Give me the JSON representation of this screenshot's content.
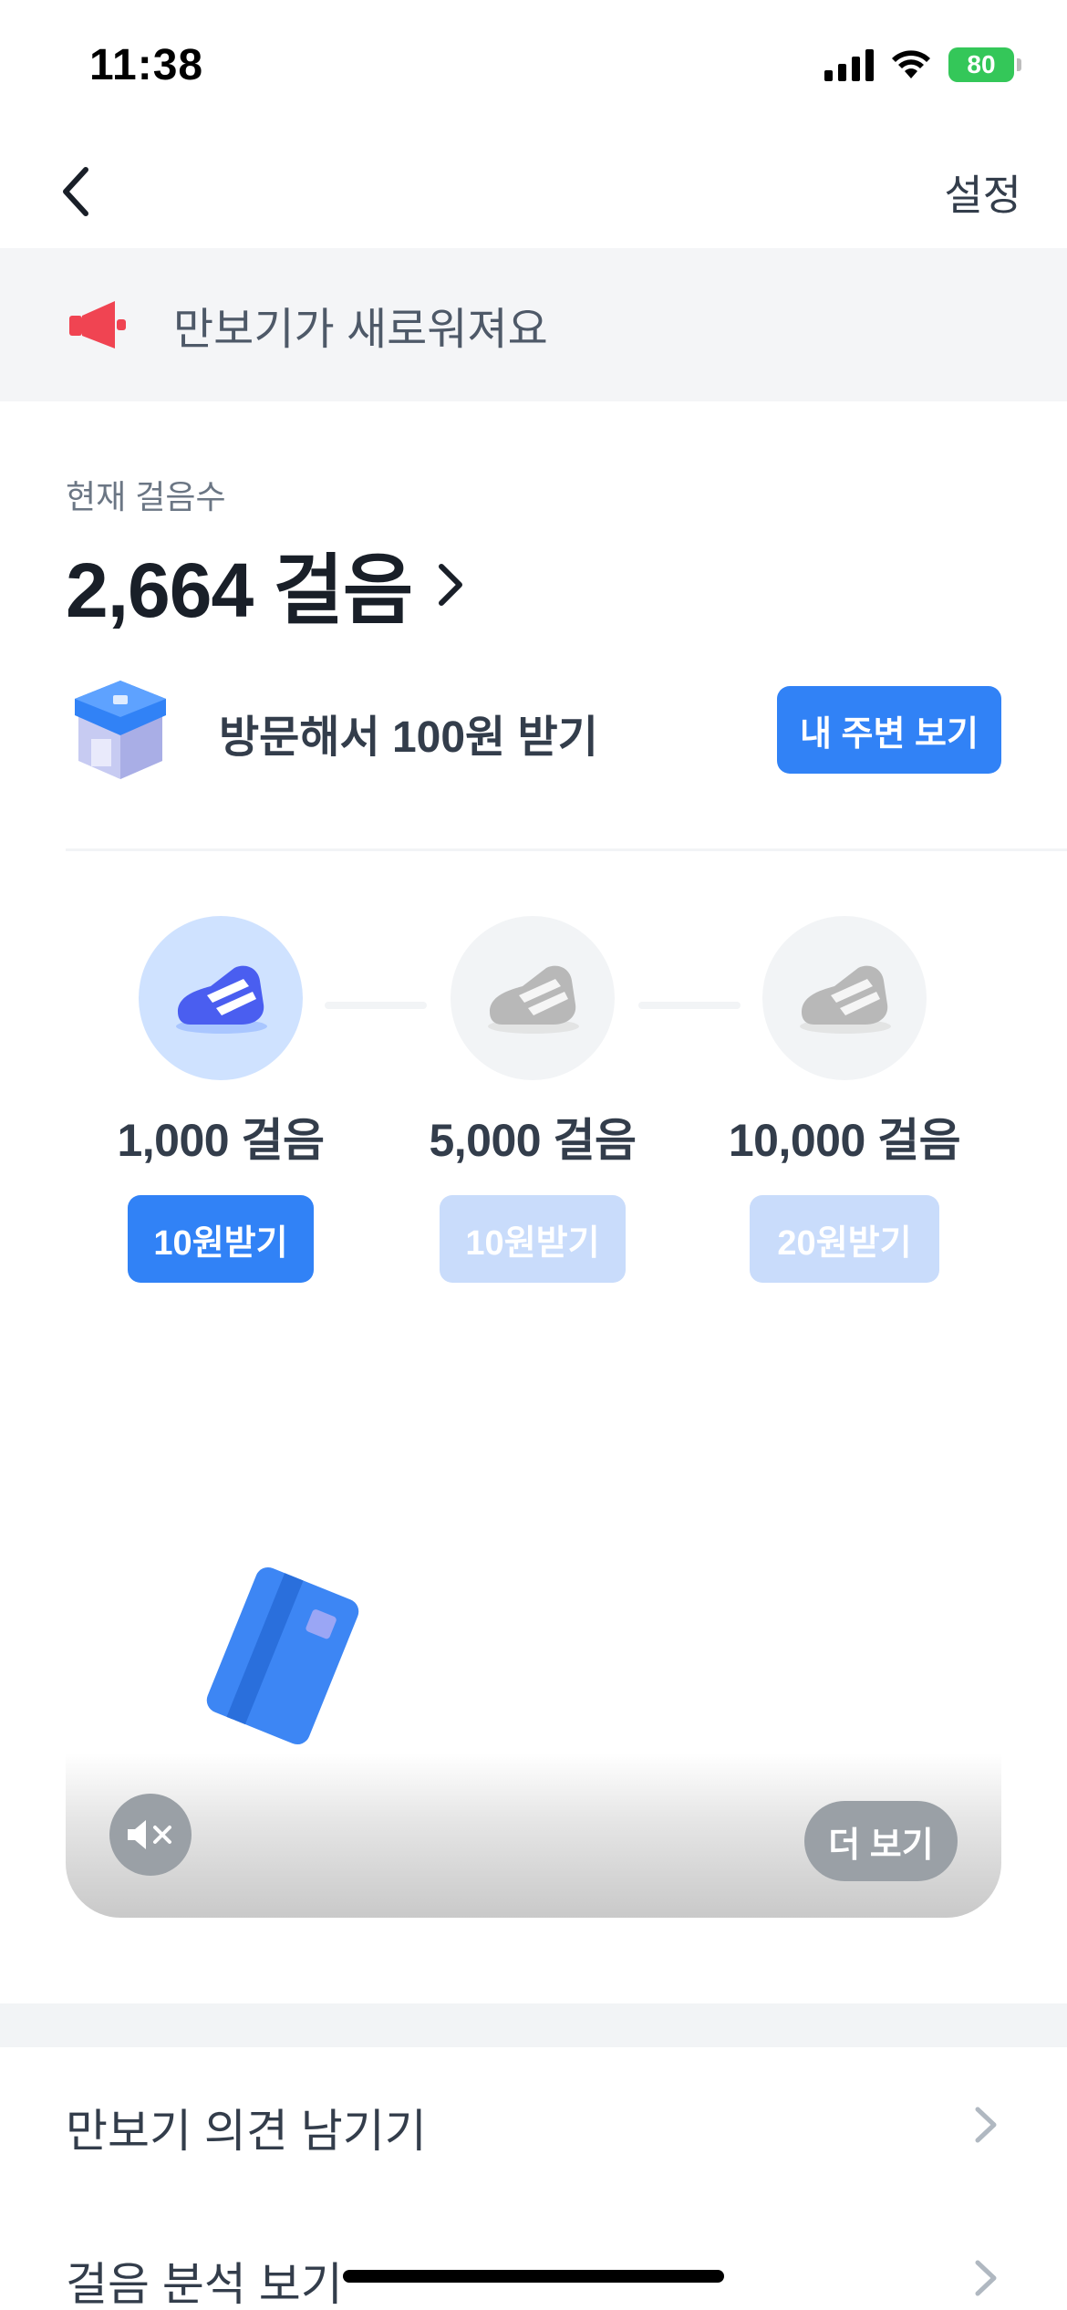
{
  "status_bar": {
    "time": "11:38",
    "battery": "80"
  },
  "nav": {
    "settings_label": "설정"
  },
  "notice": {
    "text": "만보기가 새로워져요"
  },
  "steps": {
    "label": "현재 걸음수",
    "count": "2,664 걸음"
  },
  "visit": {
    "text": "방문해서 100원 받기",
    "button_label": "내 주변 보기"
  },
  "milestones": [
    {
      "steps": "1,000 걸음",
      "button_label": "10원받기",
      "state": "active"
    },
    {
      "steps": "5,000 걸음",
      "button_label": "10원받기",
      "state": "locked"
    },
    {
      "steps": "10,000 걸음",
      "button_label": "20원받기",
      "state": "locked"
    }
  ],
  "ad": {
    "more_label": "더 보기"
  },
  "menu": [
    {
      "label": "만보기 의견 남기기"
    },
    {
      "label": "걸음 분석 보기"
    }
  ],
  "colors": {
    "accent": "#3182f6",
    "accent_light": "#c9dcfb",
    "notice_bg": "#f4f5f7"
  }
}
